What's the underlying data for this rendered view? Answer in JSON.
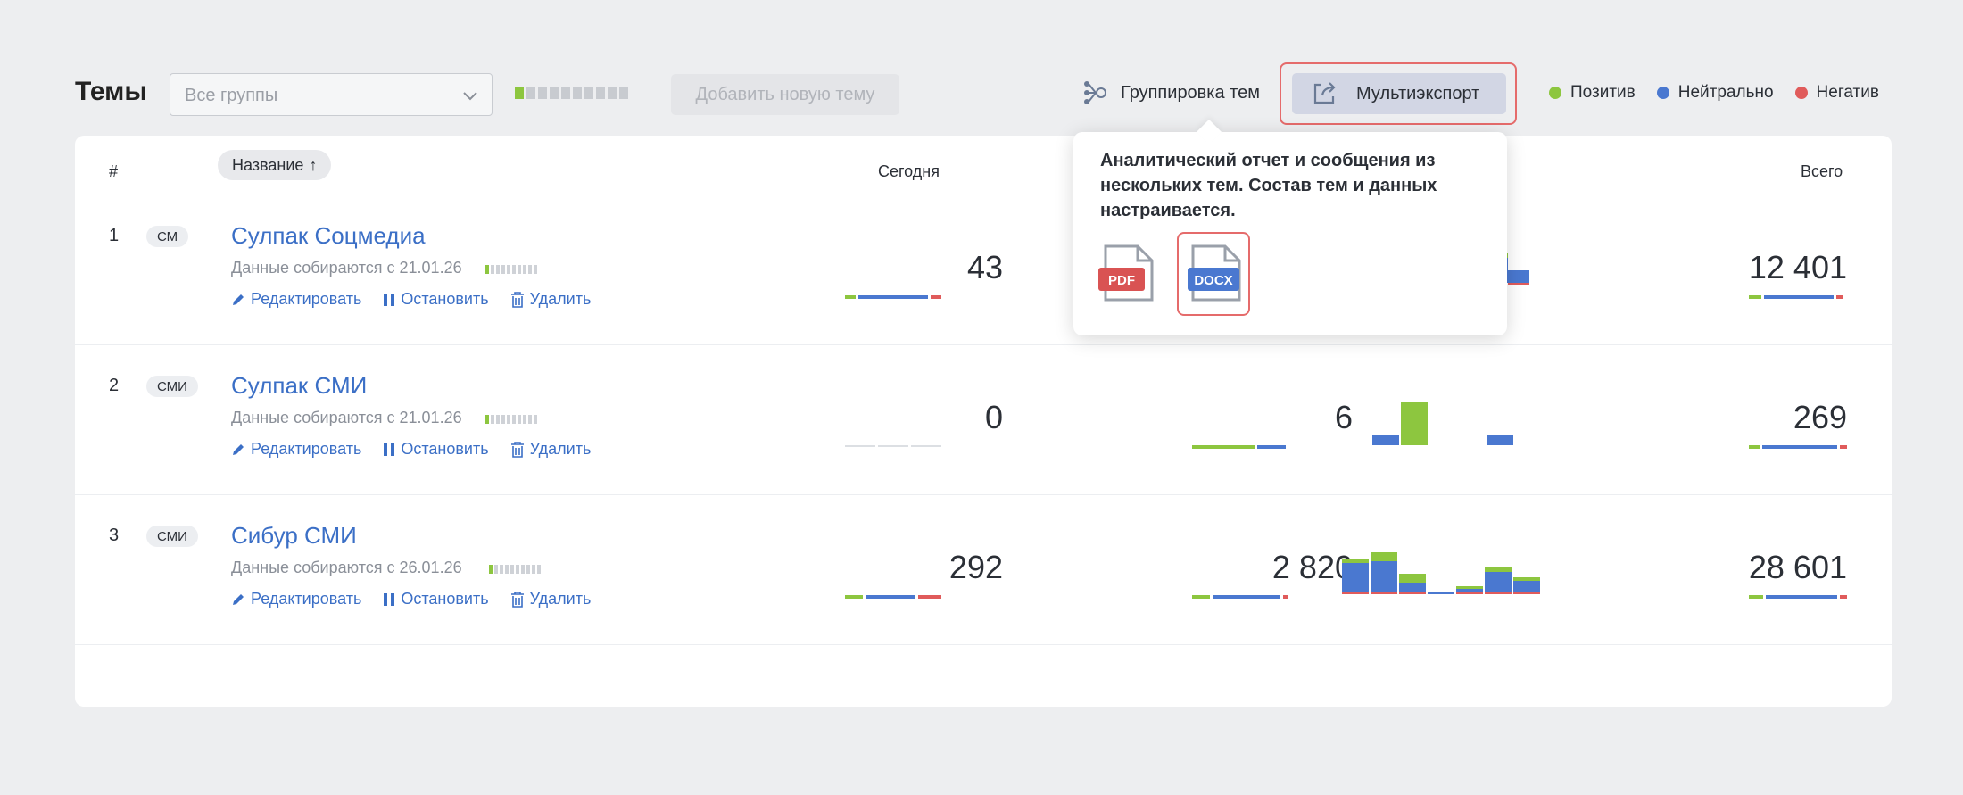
{
  "header": {
    "title": "Темы",
    "group_select_value": "Все группы",
    "quota_filled": 1,
    "quota_total": 10,
    "add_topic_label": "Добавить новую тему",
    "grouping_label": "Группировка тем",
    "multiexport_label": "Мультиэкспорт"
  },
  "legend": [
    {
      "label": "Позитив",
      "color": "#8dc63f"
    },
    {
      "label": "Нейтрально",
      "color": "#4a78d0"
    },
    {
      "label": "Негатив",
      "color": "#e05b5b"
    }
  ],
  "table": {
    "col_num": "#",
    "col_name": "Название",
    "sort_icon": "↑",
    "col_today": "Сегодня",
    "col_total": "Всего"
  },
  "actions": {
    "edit": "Редактировать",
    "stop": "Остановить",
    "delete": "Удалить"
  },
  "rows": [
    {
      "num": "1",
      "tag": "СМ",
      "name": "Сулпак Соцмедиа",
      "since": "Данные собираются с 21.01.26",
      "today": "43",
      "total": "12 401",
      "week": ""
    },
    {
      "num": "2",
      "tag": "СМИ",
      "name": "Сулпак СМИ",
      "since": "Данные собираются с 21.01.26",
      "today": "0",
      "total": "269",
      "week": "6"
    },
    {
      "num": "3",
      "tag": "СМИ",
      "name": "Сибур СМИ",
      "since": "Данные собираются с 26.01.26",
      "today": "292",
      "total": "28 601",
      "week": "2 820"
    }
  ],
  "popover": {
    "text": "Аналитический отчет и сообщения из нескольких тем. Состав тем и данных настраивается.",
    "pdf_label": "PDF",
    "docx_label": "DOCX"
  }
}
